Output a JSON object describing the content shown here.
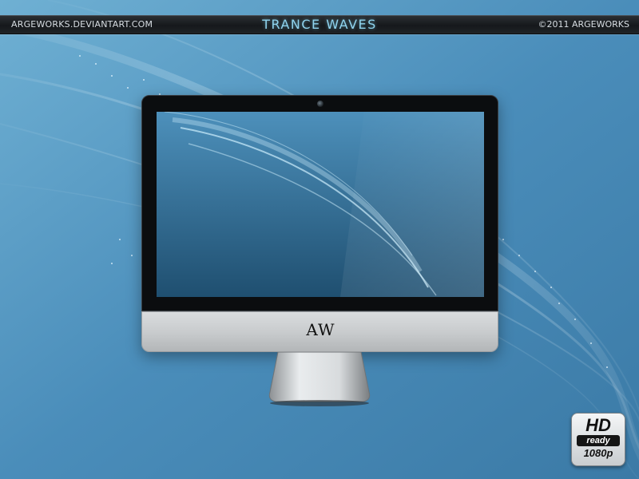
{
  "header": {
    "left_text": "ARGEWORKS.DEVIANTART.COM",
    "title": "TRANCE WAVES",
    "right_text": "©2011 ARGEWORKS"
  },
  "monitor": {
    "logo_text": "AW"
  },
  "badge": {
    "hd": "HD",
    "ready": "ready",
    "resolution": "1080p"
  },
  "colors": {
    "background": "#3f7fa6",
    "title_accent": "#8fd3ee",
    "banner": "#1b1e21"
  }
}
